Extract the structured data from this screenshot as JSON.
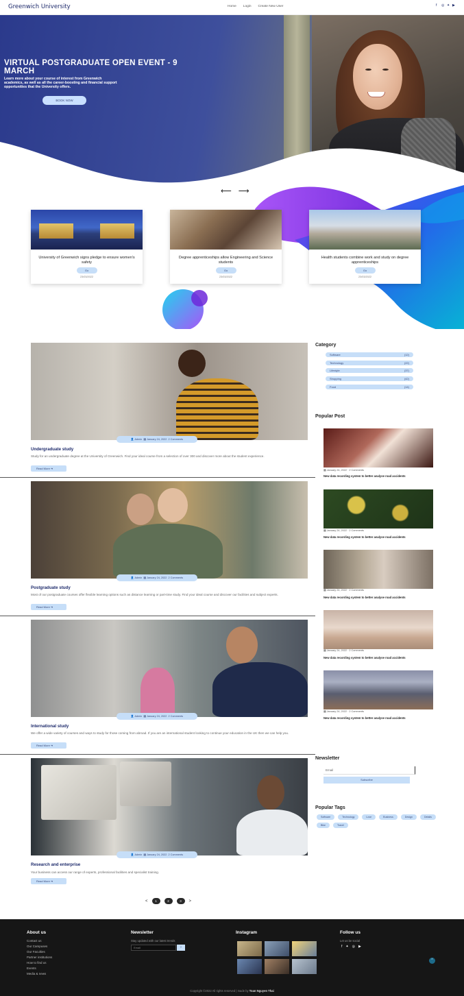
{
  "navbar": {
    "brand": "Greenwich University",
    "links": [
      "Home",
      "Login",
      "Create New User"
    ],
    "social_icons": [
      "facebook-icon",
      "instagram-icon",
      "twitter-icon",
      "youtube-icon"
    ]
  },
  "hero": {
    "title": "VIRTUAL POSTGRADUATE OPEN EVENT - 9 MARCH",
    "subtitle": "Learn more about your course of interest from Greenwich academics, as well as all the career-boosting and financial support opportunities that the University offers.",
    "button": "BOOK NOW"
  },
  "slider_arrows": {
    "prev": "⟵",
    "next": "⟶"
  },
  "cards": [
    {
      "title": "University of Greenwich signs pledge to ensure women's safety",
      "button": "Go",
      "date": "23/03/2022"
    },
    {
      "title": "Degree apprenticeships allow Engineering and Science students",
      "button": "Go",
      "date": "23/03/2022"
    },
    {
      "title": "Health students combine work and study on degree apprenticeships",
      "button": "Go",
      "date": "23/03/2022"
    }
  ],
  "posts": [
    {
      "title": "Undergraduate study",
      "excerpt": "Study for an undergraduate degree at the University of Greenwich. Find your ideal course from a selection of over 300 and discover more about the student experience.",
      "author": "Admin",
      "date": "January 24, 2022",
      "comments": "2 Comments",
      "read_more": "Read More"
    },
    {
      "title": "Postgraduate study",
      "excerpt": "Most of our postgraduate courses offer flexible learning options such as distance learning or part-time study. Find your ideal course and discover our facilities and subject experts.",
      "author": "Admin",
      "date": "January 24, 2022",
      "comments": "2 Comments",
      "read_more": "Read More"
    },
    {
      "title": "International study",
      "excerpt": "We offer a wide variety of courses and ways to study for those coming from abroad. If you are an international student looking to continue your education in the UK then we can help you.",
      "author": "Admin",
      "date": "January 24, 2022",
      "comments": "2 Comments",
      "read_more": "Read More"
    },
    {
      "title": "Research and enterprise",
      "excerpt": "Your business can access our range of experts, professional facilities and specialist training.",
      "author": "Admin",
      "date": "January 24, 2022",
      "comments": "2 Comments",
      "read_more": "Read More"
    }
  ],
  "sidebar": {
    "category_heading": "Category",
    "categories": [
      {
        "name": "Software",
        "count": "(12)"
      },
      {
        "name": "Technology",
        "count": "(22)"
      },
      {
        "name": "Lifestyle",
        "count": "(37)"
      },
      {
        "name": "Shopping",
        "count": "(42)"
      },
      {
        "name": "Food",
        "count": "(14)"
      }
    ],
    "popular_heading": "Popular Post",
    "popular_posts": [
      {
        "meta": "January 24, 2022 · 2 Comments",
        "title": "New data recording system to better analyse road accidents"
      },
      {
        "meta": "January 24, 2022 · 2 Comments",
        "title": "New data recording system to better analyse road accidents"
      },
      {
        "meta": "January 24, 2022 · 2 Comments",
        "title": "New data recording system to better analyse road accidents"
      },
      {
        "meta": "January 24, 2022 · 2 Comments",
        "title": "New data recording system to better analyse road accidents"
      },
      {
        "meta": "January 24, 2022 · 2 Comments",
        "title": "New data recording system to better analyse road accidents"
      }
    ],
    "newsletter_heading": "Newsletter",
    "newsletter_placeholder": "Email",
    "newsletter_button": "Subscribe",
    "tags_heading": "Popular Tags",
    "tags": [
      "Software",
      "Technology",
      "Love",
      "Business",
      "Design",
      "Details",
      "Bike",
      "Travel"
    ]
  },
  "pagination": {
    "prev": "<",
    "pages": [
      "1",
      "2",
      "3"
    ],
    "next": ">"
  },
  "footer": {
    "about_heading": "About us",
    "about_links": [
      "Contact us",
      "Our Campuses",
      "Our Faculties",
      "Partner institutions",
      "How to find us",
      "Events",
      "Media & news"
    ],
    "newsletter_heading": "Newsletter",
    "newsletter_text": "Stay updated with our latest trends",
    "newsletter_placeholder": "Email",
    "newsletter_go": "›",
    "instagram_heading": "Instagram",
    "follow_heading": "Follow us",
    "follow_text": "Let us be social",
    "copyright_prefix": "Copyright ©2022 All rights reserved | made by",
    "copyright_author": "Toan Nguyen Thai",
    "to_top": "⌃"
  }
}
